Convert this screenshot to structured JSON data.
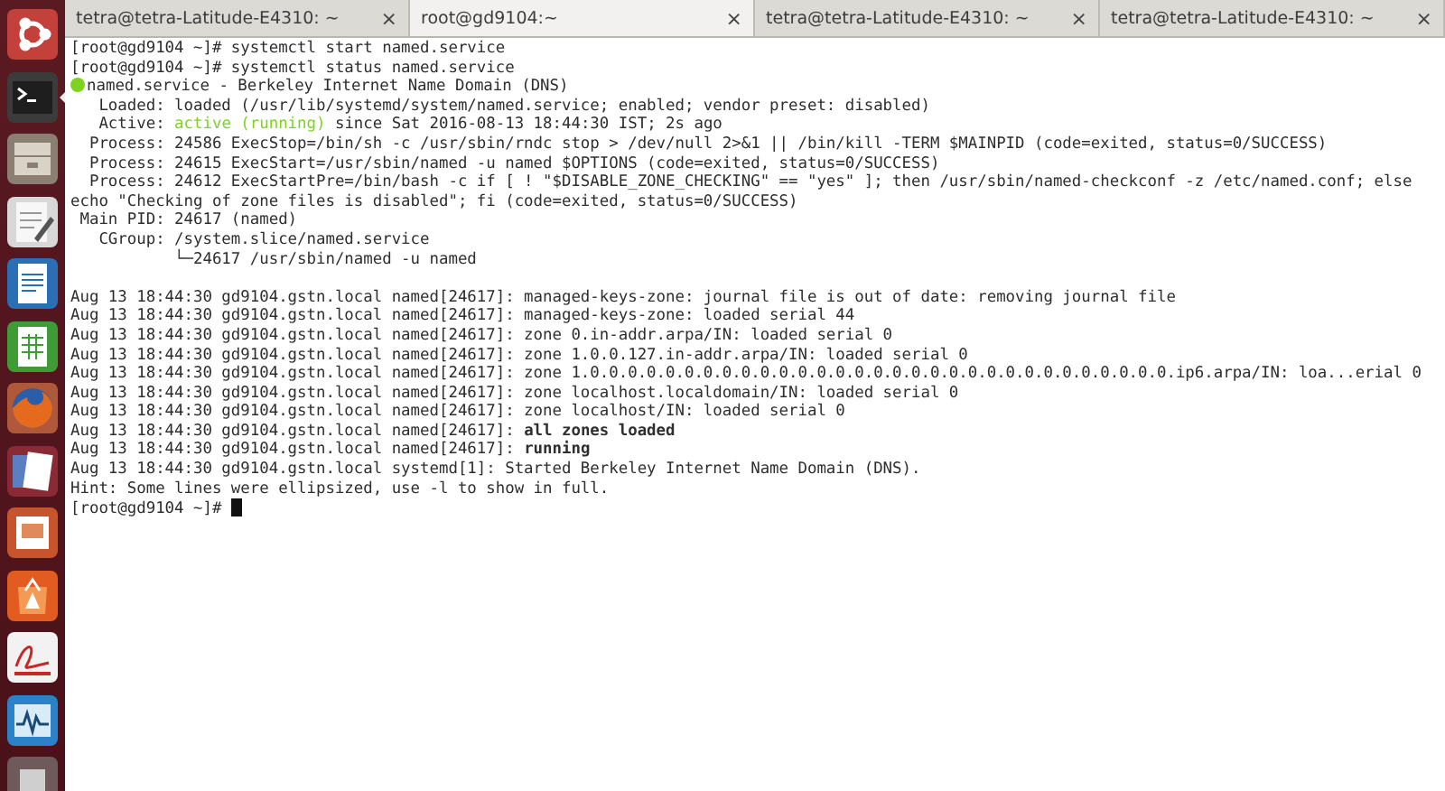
{
  "launcher": {
    "items": [
      {
        "kind": "ubuntu",
        "running": false
      },
      {
        "kind": "terminal",
        "running": true
      },
      {
        "kind": "files",
        "running": false
      },
      {
        "kind": "editor",
        "running": false
      },
      {
        "kind": "writer",
        "running": false
      },
      {
        "kind": "calc",
        "running": false
      },
      {
        "kind": "firefox",
        "running": false
      },
      {
        "kind": "document",
        "running": false
      },
      {
        "kind": "impress",
        "running": false
      },
      {
        "kind": "store",
        "running": false
      },
      {
        "kind": "reader",
        "running": false
      },
      {
        "kind": "monitor",
        "running": false
      },
      {
        "kind": "trash",
        "running": false
      }
    ]
  },
  "tabs": [
    {
      "label": "tetra@tetra-Latitude-E4310: ~",
      "close": "×",
      "selected": false
    },
    {
      "label": "root@gd9104:~",
      "close": "×",
      "selected": true
    },
    {
      "label": "tetra@tetra-Latitude-E4310: ~",
      "close": "×",
      "selected": false
    },
    {
      "label": "tetra@tetra-Latitude-E4310: ~",
      "close": "×",
      "selected": false
    }
  ],
  "terminal": {
    "lines": [
      {
        "kind": "text",
        "text": "[root@gd9104 ~]# systemctl start named.service"
      },
      {
        "kind": "text",
        "text": "[root@gd9104 ~]# systemctl status named.service"
      },
      {
        "kind": "unit",
        "text": "named.service - Berkeley Internet Name Domain (DNS)"
      },
      {
        "kind": "text",
        "text": "   Loaded: loaded (/usr/lib/systemd/system/named.service; enabled; vendor preset: disabled)"
      },
      {
        "kind": "active",
        "label": "   Active: ",
        "state": "active (running)",
        "text": " since Sat 2016-08-13 18:44:30 IST; 2s ago"
      },
      {
        "kind": "text",
        "text": "  Process: 24586 ExecStop=/bin/sh -c /usr/sbin/rndc stop > /dev/null 2>&1 || /bin/kill -TERM $MAINPID (code=exited, status=0/SUCCESS)"
      },
      {
        "kind": "text",
        "text": "  Process: 24615 ExecStart=/usr/sbin/named -u named $OPTIONS (code=exited, status=0/SUCCESS)"
      },
      {
        "kind": "text",
        "text": "  Process: 24612 ExecStartPre=/bin/bash -c if [ ! \"$DISABLE_ZONE_CHECKING\" == \"yes\" ]; then /usr/sbin/named-checkconf -z /etc/named.conf; else"
      },
      {
        "kind": "text",
        "text": "echo \"Checking of zone files is disabled\"; fi (code=exited, status=0/SUCCESS)"
      },
      {
        "kind": "text",
        "text": " Main PID: 24617 (named)"
      },
      {
        "kind": "text",
        "text": "   CGroup: /system.slice/named.service"
      },
      {
        "kind": "text",
        "text": "           └─24617 /usr/sbin/named -u named"
      },
      {
        "kind": "blank"
      },
      {
        "kind": "text",
        "text": "Aug 13 18:44:30 gd9104.gstn.local named[24617]: managed-keys-zone: journal file is out of date: removing journal file"
      },
      {
        "kind": "text",
        "text": "Aug 13 18:44:30 gd9104.gstn.local named[24617]: managed-keys-zone: loaded serial 44"
      },
      {
        "kind": "text",
        "text": "Aug 13 18:44:30 gd9104.gstn.local named[24617]: zone 0.in-addr.arpa/IN: loaded serial 0"
      },
      {
        "kind": "text",
        "text": "Aug 13 18:44:30 gd9104.gstn.local named[24617]: zone 1.0.0.127.in-addr.arpa/IN: loaded serial 0"
      },
      {
        "kind": "text",
        "text": "Aug 13 18:44:30 gd9104.gstn.local named[24617]: zone 1.0.0.0.0.0.0.0.0.0.0.0.0.0.0.0.0.0.0.0.0.0.0.0.0.0.0.0.0.0.0.0.ip6.arpa/IN: loa...erial 0"
      },
      {
        "kind": "text",
        "text": "Aug 13 18:44:30 gd9104.gstn.local named[24617]: zone localhost.localdomain/IN: loaded serial 0"
      },
      {
        "kind": "text",
        "text": "Aug 13 18:44:30 gd9104.gstn.local named[24617]: zone localhost/IN: loaded serial 0"
      },
      {
        "kind": "text",
        "text": "Aug 13 18:44:30 gd9104.gstn.local named[24617]: **all zones loaded**"
      },
      {
        "kind": "text",
        "text": "Aug 13 18:44:30 gd9104.gstn.local named[24617]: **running**"
      },
      {
        "kind": "text",
        "text": "Aug 13 18:44:30 gd9104.gstn.local systemd[1]: Started Berkeley Internet Name Domain (DNS)."
      },
      {
        "kind": "text",
        "text": "Hint: Some lines were ellipsized, use -l to show in full."
      },
      {
        "kind": "prompt",
        "text": "[root@gd9104 ~]# "
      }
    ]
  }
}
